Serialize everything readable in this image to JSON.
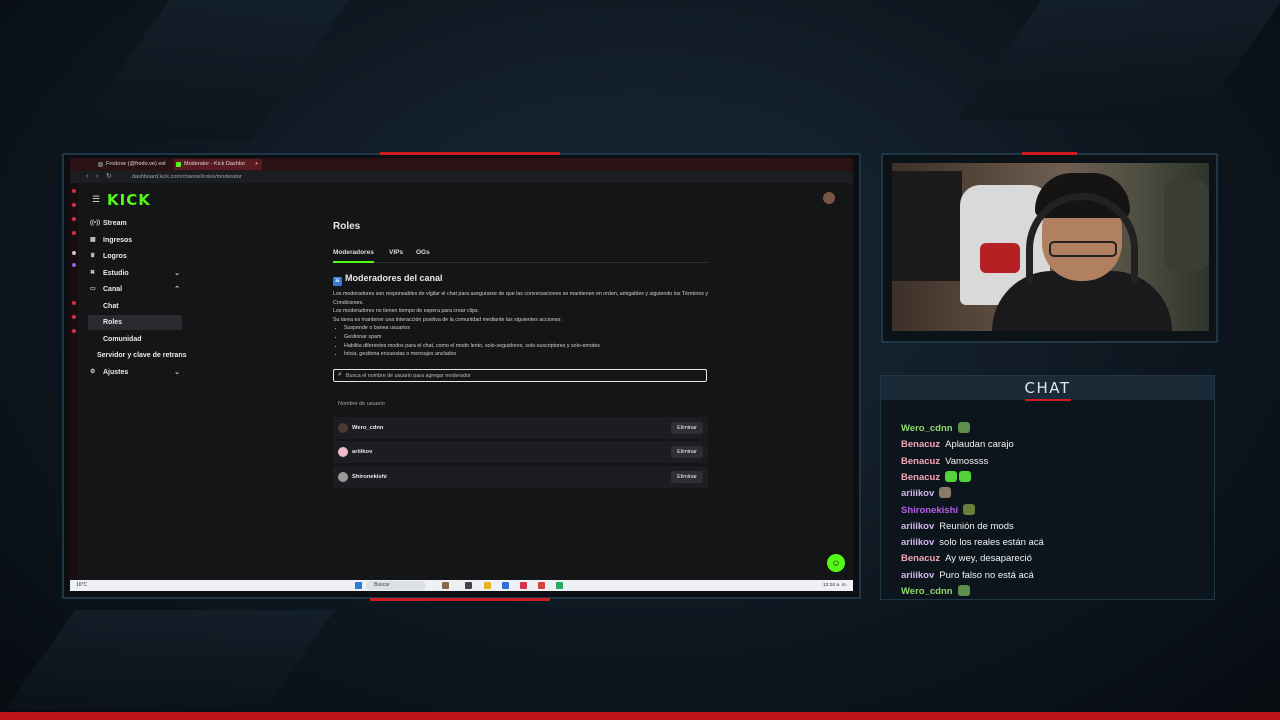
{
  "colors": {
    "accent_red": "#d01a22",
    "kick_green": "#53fc18",
    "user_green": "#8fd86a",
    "user_pink": "#f7a6b6",
    "user_purple": "#b45ee6",
    "user_lavender": "#d4b7ee"
  },
  "browser": {
    "tabs": [
      {
        "label": "Frodove (@frodo.ve) est",
        "active": false
      },
      {
        "label": "Moderator - Kick Dashbo",
        "active": true
      }
    ],
    "new_tab": "+",
    "url": "dashboard.kick.com/channel/roles/moderator"
  },
  "kick": {
    "logo": "KICK",
    "sidebar": [
      {
        "label": "Stream",
        "icon": "broadcast-icon"
      },
      {
        "label": "Ingresos",
        "icon": "wallet-icon"
      },
      {
        "label": "Logros",
        "icon": "trophy-icon"
      },
      {
        "label": "Estudio",
        "icon": "studio-icon",
        "chevron": "⌄"
      },
      {
        "label": "Canal",
        "icon": "channel-icon",
        "chevron": "⌃"
      },
      {
        "label": "Chat",
        "icon": ""
      },
      {
        "label": "Roles",
        "icon": "",
        "active": true
      },
      {
        "label": "Comunidad",
        "icon": ""
      },
      {
        "label": "Servidor y clave de retrans",
        "icon": ""
      },
      {
        "label": "Ajustes",
        "icon": "gear-icon",
        "chevron": "⌄"
      }
    ],
    "page_title": "Roles",
    "tabs": [
      "Moderadores",
      "VIPs",
      "OGs"
    ],
    "section_title": "Moderadores del canal",
    "desc_lines": [
      "Los moderadores son responsables de vigilar el chat para asegurarse de que las conversaciones se mantienen en orden, amigables y siguiendo los Términos y Condiciones.",
      "Los moderadores no tienen tiempo de espera para crear clips.",
      "Su tarea es mantener una interacción positiva de la comunidad mediante las siguientes acciones:"
    ],
    "bullets": [
      "Suspende o banea usuarios",
      "Gestionar spam",
      "Habilita diferentes modos para el chat, como el modo lento, solo-seguidores, solo-suscriptores y solo-emotes",
      "Inicia, gestiona encuestas o mensajes anclados"
    ],
    "search_placeholder": "Busca el nombre de usuario para agregar moderador",
    "column_header": "Nombre de usuario",
    "moderators": [
      {
        "name": "Wero_cdnn",
        "avatar_color": "#4a3a33"
      },
      {
        "name": "ariiikov",
        "avatar_color": "#f0b8c8"
      },
      {
        "name": "Shironekishi",
        "avatar_color": "#9a9a9a"
      }
    ],
    "remove_label": "Eliminar"
  },
  "taskbar": {
    "weather": "16°C",
    "search": "Buscar",
    "clock": "12:26 a. m."
  },
  "chat": {
    "title": "CHAT",
    "messages": [
      {
        "user": "Wero_cdnn",
        "color": "#8fd86a",
        "text": "",
        "emotes": [
          "#5e8f4a"
        ]
      },
      {
        "user": "Benacuz",
        "color": "#f7a6b6",
        "text": "Aplaudan carajo",
        "emotes": []
      },
      {
        "user": "Benacuz",
        "color": "#f7a6b6",
        "text": "Vamossss",
        "emotes": []
      },
      {
        "user": "Benacuz",
        "color": "#f7a6b6",
        "text": "",
        "emotes": [
          "#53d23a",
          "#53d23a"
        ]
      },
      {
        "user": "ariiikov",
        "color": "#d4b7ee",
        "text": "",
        "emotes": [
          "#8a7a66"
        ]
      },
      {
        "user": "Shironekishi",
        "color": "#b45ee6",
        "text": "",
        "emotes": [
          "#6a7d3a"
        ]
      },
      {
        "user": "ariiikov",
        "color": "#d4b7ee",
        "text": "Reunión de mods",
        "emotes": []
      },
      {
        "user": "ariiikov",
        "color": "#d4b7ee",
        "text": "solo los reales están acá",
        "emotes": []
      },
      {
        "user": "Benacuz",
        "color": "#f7a6b6",
        "text": "Ay wey, desapareció",
        "emotes": []
      },
      {
        "user": "ariiikov",
        "color": "#d4b7ee",
        "text": "Puro falso no está acá",
        "emotes": []
      },
      {
        "user": "Wero_cdnn",
        "color": "#8fd86a",
        "text": "",
        "emotes": [
          "#5e8f4a"
        ]
      }
    ]
  }
}
